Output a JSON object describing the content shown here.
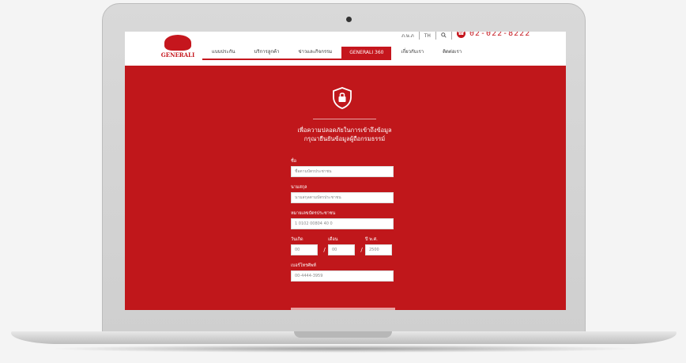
{
  "site": {
    "logo_text": "GENERALI",
    "phone": "02-022-8222",
    "top_links": [
      "ภ.ษ.ภ",
      "TH"
    ],
    "nav": [
      {
        "label": "แบบประกัน",
        "active": false
      },
      {
        "label": "บริการลูกค้า",
        "active": false
      },
      {
        "label": "ข่าวและกิจกรรม",
        "active": false
      },
      {
        "label": "GENERALI 360",
        "active": true
      },
      {
        "label": "เกี่ยวกับเรา",
        "active": false,
        "plain": true
      },
      {
        "label": "ติดต่อเรา",
        "active": false,
        "plain": true
      }
    ]
  },
  "page": {
    "heading_line1": "เพื่อความปลอดภัยในการเข้าถึงข้อมูล",
    "heading_line2": "กรุณายืนยันข้อมูลผู้ถือกรมธรรม์",
    "shield_icon": "shield-lock-icon",
    "fields": {
      "first_name_label": "ชื่อ",
      "first_name_placeholder": "ชื่อตามบัตรประชาชน",
      "last_name_label": "นามสกุล",
      "last_name_placeholder": "นามสกุลตามบัตรประชาชน",
      "id_label": "หมายเลขบัตรประชาชน",
      "id_value": "1 0102 00804 40 0",
      "day_label": "วันเกิด",
      "day_value": "00",
      "month_label": "เดือน",
      "month_value": "00",
      "year_label": "ปี พ.ศ.",
      "year_value": "2500",
      "phone_label": "เบอร์โทรศัพท์",
      "phone_value": "00-4444-3959",
      "date_separator": "/"
    }
  },
  "colors": {
    "brand_red": "#c0171b",
    "white": "#ffffff"
  }
}
